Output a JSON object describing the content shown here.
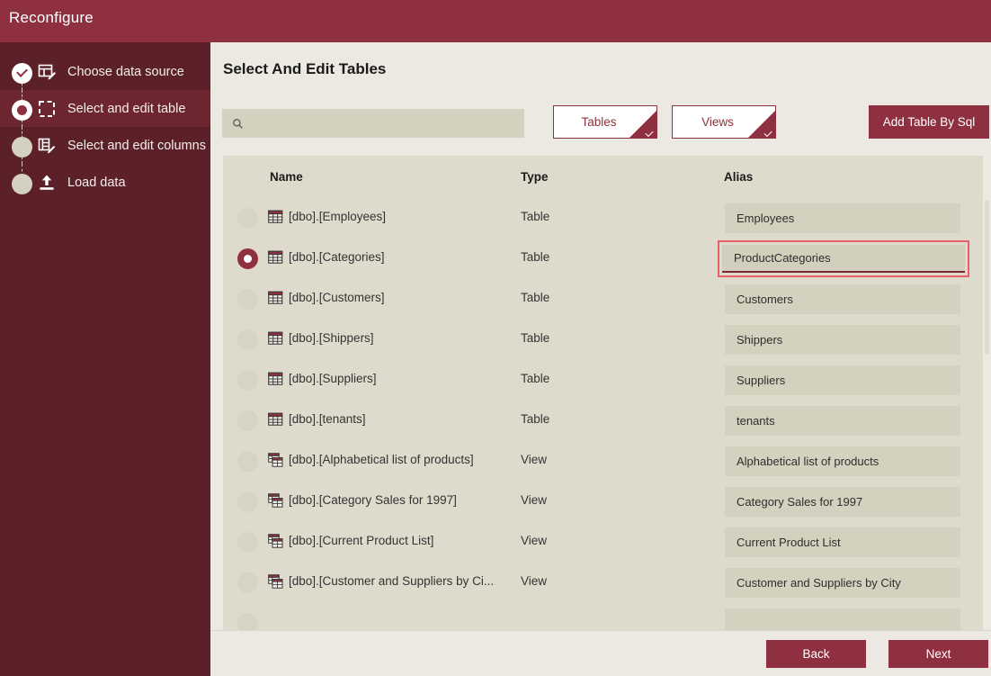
{
  "window": {
    "title": "Reconfigure",
    "accent": "#8f3040",
    "sidebar_bg": "#5b2028",
    "page_bg": "#ece9e2",
    "panel_bg": "#dedbcc",
    "field_bg": "#d5d1bf",
    "focus_outline": "#e8616a"
  },
  "sidebar": {
    "items": [
      {
        "label": "Choose data source",
        "icon": "table-edit-icon",
        "state": "done"
      },
      {
        "label": "Select and edit table",
        "icon": "dashed-square-icon",
        "state": "current"
      },
      {
        "label": "Select and edit columns",
        "icon": "list-edit-icon",
        "state": "pending"
      },
      {
        "label": "Load data",
        "icon": "upload-icon",
        "state": "pending"
      }
    ]
  },
  "main": {
    "page_title": "Select And Edit Tables",
    "search": {
      "value": "",
      "placeholder": "",
      "icon": "search-icon"
    },
    "filter_buttons": [
      {
        "label": "Tables",
        "selected": true,
        "icon": "check-corner-icon"
      },
      {
        "label": "Views",
        "selected": true,
        "icon": "check-corner-icon"
      }
    ],
    "sql_button": {
      "label": "Add Table By Sql"
    },
    "columns": [
      "Name",
      "Type",
      "Alias"
    ],
    "rows": [
      {
        "name": "[dbo].[Employees]",
        "type": "Table",
        "alias": "Employees",
        "icon": "table-icon",
        "selected": false,
        "focused": false
      },
      {
        "name": "[dbo].[Categories]",
        "type": "Table",
        "alias": "ProductCategories",
        "icon": "table-icon",
        "selected": true,
        "focused": true
      },
      {
        "name": "[dbo].[Customers]",
        "type": "Table",
        "alias": "Customers",
        "icon": "table-icon",
        "selected": false,
        "focused": false
      },
      {
        "name": "[dbo].[Shippers]",
        "type": "Table",
        "alias": "Shippers",
        "icon": "table-icon",
        "selected": false,
        "focused": false
      },
      {
        "name": "[dbo].[Suppliers]",
        "type": "Table",
        "alias": "Suppliers",
        "icon": "table-icon",
        "selected": false,
        "focused": false
      },
      {
        "name": "[dbo].[tenants]",
        "type": "Table",
        "alias": "tenants",
        "icon": "table-icon",
        "selected": false,
        "focused": false
      },
      {
        "name": "[dbo].[Alphabetical list of products]",
        "type": "View",
        "alias": "Alphabetical list of products",
        "icon": "view-icon",
        "selected": false,
        "focused": false
      },
      {
        "name": "[dbo].[Category Sales for 1997]",
        "type": "View",
        "alias": "Category Sales for 1997",
        "icon": "view-icon",
        "selected": false,
        "focused": false
      },
      {
        "name": "[dbo].[Current Product List]",
        "type": "View",
        "alias": "Current Product List",
        "icon": "view-icon",
        "selected": false,
        "focused": false
      },
      {
        "name": "[dbo].[Customer and Suppliers by Ci...",
        "type": "View",
        "alias": "Customer and Suppliers by City",
        "icon": "view-icon",
        "selected": false,
        "focused": false
      },
      {
        "name": "",
        "type": "",
        "alias": "",
        "icon": "view-icon",
        "selected": false,
        "focused": false
      }
    ]
  },
  "footer": {
    "back_label": "Back",
    "next_label": "Next"
  }
}
